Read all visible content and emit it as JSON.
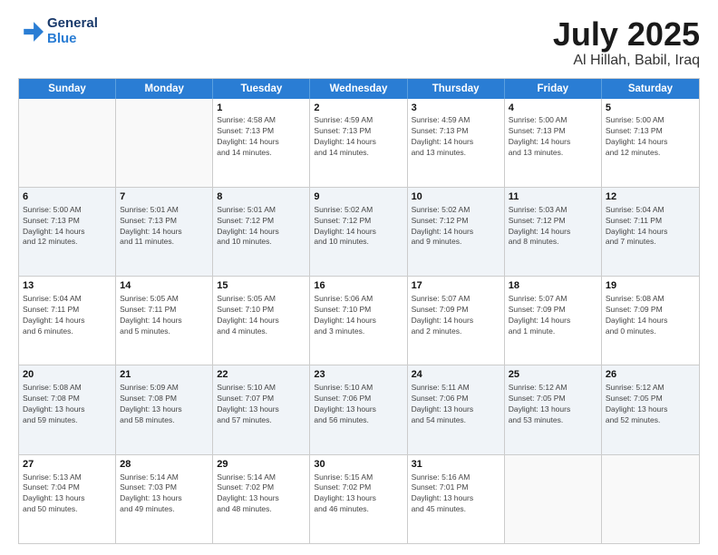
{
  "logo": {
    "line1": "General",
    "line2": "Blue"
  },
  "title": "July 2025",
  "subtitle": "Al Hillah, Babil, Iraq",
  "days_header": [
    "Sunday",
    "Monday",
    "Tuesday",
    "Wednesday",
    "Thursday",
    "Friday",
    "Saturday"
  ],
  "weeks": [
    [
      {
        "day": "",
        "info": ""
      },
      {
        "day": "",
        "info": ""
      },
      {
        "day": "1",
        "info": "Sunrise: 4:58 AM\nSunset: 7:13 PM\nDaylight: 14 hours\nand 14 minutes."
      },
      {
        "day": "2",
        "info": "Sunrise: 4:59 AM\nSunset: 7:13 PM\nDaylight: 14 hours\nand 14 minutes."
      },
      {
        "day": "3",
        "info": "Sunrise: 4:59 AM\nSunset: 7:13 PM\nDaylight: 14 hours\nand 13 minutes."
      },
      {
        "day": "4",
        "info": "Sunrise: 5:00 AM\nSunset: 7:13 PM\nDaylight: 14 hours\nand 13 minutes."
      },
      {
        "day": "5",
        "info": "Sunrise: 5:00 AM\nSunset: 7:13 PM\nDaylight: 14 hours\nand 12 minutes."
      }
    ],
    [
      {
        "day": "6",
        "info": "Sunrise: 5:00 AM\nSunset: 7:13 PM\nDaylight: 14 hours\nand 12 minutes."
      },
      {
        "day": "7",
        "info": "Sunrise: 5:01 AM\nSunset: 7:13 PM\nDaylight: 14 hours\nand 11 minutes."
      },
      {
        "day": "8",
        "info": "Sunrise: 5:01 AM\nSunset: 7:12 PM\nDaylight: 14 hours\nand 10 minutes."
      },
      {
        "day": "9",
        "info": "Sunrise: 5:02 AM\nSunset: 7:12 PM\nDaylight: 14 hours\nand 10 minutes."
      },
      {
        "day": "10",
        "info": "Sunrise: 5:02 AM\nSunset: 7:12 PM\nDaylight: 14 hours\nand 9 minutes."
      },
      {
        "day": "11",
        "info": "Sunrise: 5:03 AM\nSunset: 7:12 PM\nDaylight: 14 hours\nand 8 minutes."
      },
      {
        "day": "12",
        "info": "Sunrise: 5:04 AM\nSunset: 7:11 PM\nDaylight: 14 hours\nand 7 minutes."
      }
    ],
    [
      {
        "day": "13",
        "info": "Sunrise: 5:04 AM\nSunset: 7:11 PM\nDaylight: 14 hours\nand 6 minutes."
      },
      {
        "day": "14",
        "info": "Sunrise: 5:05 AM\nSunset: 7:11 PM\nDaylight: 14 hours\nand 5 minutes."
      },
      {
        "day": "15",
        "info": "Sunrise: 5:05 AM\nSunset: 7:10 PM\nDaylight: 14 hours\nand 4 minutes."
      },
      {
        "day": "16",
        "info": "Sunrise: 5:06 AM\nSunset: 7:10 PM\nDaylight: 14 hours\nand 3 minutes."
      },
      {
        "day": "17",
        "info": "Sunrise: 5:07 AM\nSunset: 7:09 PM\nDaylight: 14 hours\nand 2 minutes."
      },
      {
        "day": "18",
        "info": "Sunrise: 5:07 AM\nSunset: 7:09 PM\nDaylight: 14 hours\nand 1 minute."
      },
      {
        "day": "19",
        "info": "Sunrise: 5:08 AM\nSunset: 7:09 PM\nDaylight: 14 hours\nand 0 minutes."
      }
    ],
    [
      {
        "day": "20",
        "info": "Sunrise: 5:08 AM\nSunset: 7:08 PM\nDaylight: 13 hours\nand 59 minutes."
      },
      {
        "day": "21",
        "info": "Sunrise: 5:09 AM\nSunset: 7:08 PM\nDaylight: 13 hours\nand 58 minutes."
      },
      {
        "day": "22",
        "info": "Sunrise: 5:10 AM\nSunset: 7:07 PM\nDaylight: 13 hours\nand 57 minutes."
      },
      {
        "day": "23",
        "info": "Sunrise: 5:10 AM\nSunset: 7:06 PM\nDaylight: 13 hours\nand 56 minutes."
      },
      {
        "day": "24",
        "info": "Sunrise: 5:11 AM\nSunset: 7:06 PM\nDaylight: 13 hours\nand 54 minutes."
      },
      {
        "day": "25",
        "info": "Sunrise: 5:12 AM\nSunset: 7:05 PM\nDaylight: 13 hours\nand 53 minutes."
      },
      {
        "day": "26",
        "info": "Sunrise: 5:12 AM\nSunset: 7:05 PM\nDaylight: 13 hours\nand 52 minutes."
      }
    ],
    [
      {
        "day": "27",
        "info": "Sunrise: 5:13 AM\nSunset: 7:04 PM\nDaylight: 13 hours\nand 50 minutes."
      },
      {
        "day": "28",
        "info": "Sunrise: 5:14 AM\nSunset: 7:03 PM\nDaylight: 13 hours\nand 49 minutes."
      },
      {
        "day": "29",
        "info": "Sunrise: 5:14 AM\nSunset: 7:02 PM\nDaylight: 13 hours\nand 48 minutes."
      },
      {
        "day": "30",
        "info": "Sunrise: 5:15 AM\nSunset: 7:02 PM\nDaylight: 13 hours\nand 46 minutes."
      },
      {
        "day": "31",
        "info": "Sunrise: 5:16 AM\nSunset: 7:01 PM\nDaylight: 13 hours\nand 45 minutes."
      },
      {
        "day": "",
        "info": ""
      },
      {
        "day": "",
        "info": ""
      }
    ]
  ]
}
